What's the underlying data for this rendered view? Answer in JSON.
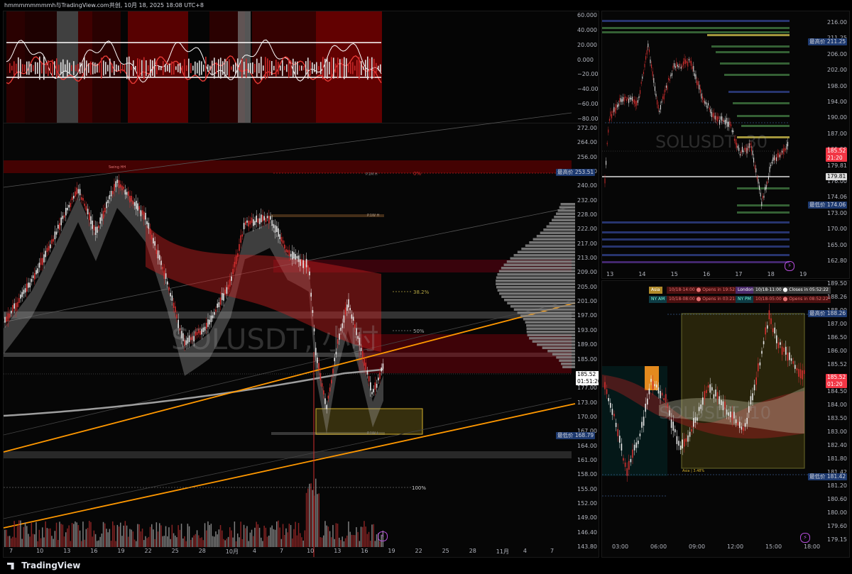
{
  "header": {
    "text": "hmmmmmmmmh与TradingView.com共创, 10月 18, 2025 18:08 UTC+8"
  },
  "footer": {
    "brand": "TradingView"
  },
  "icons": {
    "logo": "tradingview-logo-icon",
    "lightning": "lightning-icon"
  },
  "colors": {
    "bull": "#e8e8e8",
    "bear": "#d32f2f",
    "orange": "#ff9800",
    "red_tag": "#f23645",
    "blue_tag": "#1e3a70",
    "olive": "#b5a642"
  },
  "main_chart": {
    "symbol_watermark": "SOLUSDT, 小时",
    "price_axis": [
      "272.00",
      "264.00",
      "256.00",
      "248.00",
      "240.00",
      "232.00",
      "228.00",
      "222.00",
      "217.00",
      "213.00",
      "209.00",
      "205.00",
      "201.00",
      "197.00",
      "193.00",
      "189.00",
      "185.00",
      "181.00",
      "177.00",
      "173.00",
      "170.00",
      "167.00",
      "164.00",
      "161.00",
      "158.00",
      "155.00",
      "152.00",
      "149.00",
      "146.40",
      "143.80"
    ],
    "time_axis": [
      "7",
      "10",
      "13",
      "16",
      "19",
      "22",
      "25",
      "28",
      "10月",
      "4",
      "7",
      "10",
      "13",
      "16",
      "19",
      "22",
      "25",
      "28",
      "11月",
      "4",
      "7"
    ],
    "high_label": "最高价",
    "high_value": "253.51",
    "low_label": "最低价",
    "low_value": "168.79",
    "current_price": "185.52",
    "current_timer": "01:51:20",
    "fib": {
      "zero": "0%",
      "f382": "38.2%",
      "f50": "50%",
      "f100": "100%"
    },
    "labels": {
      "swing_hh": "Swing HH",
      "p1m_h": "P.1M H",
      "p1w_h": "P.1W H",
      "p1w_l": "P.1W L"
    }
  },
  "oscillator": {
    "axis": [
      "60.000",
      "40.000",
      "20.000",
      "0.000",
      "−20.000",
      "−40.000",
      "−60.000",
      "−80.000"
    ]
  },
  "right_top": {
    "watermark": "SOLUSDT, 30",
    "price_axis": [
      "216.00",
      "211.25",
      "206.00",
      "202.00",
      "198.00",
      "194.00",
      "190.00",
      "187.00",
      "185.52",
      "179.81",
      "176.00",
      "174.06",
      "173.00",
      "170.00",
      "165.00",
      "162.80"
    ],
    "time_axis": [
      "13",
      "14",
      "15",
      "16",
      "17",
      "18",
      "19"
    ],
    "high_label": "最高价",
    "high_value": "211.25",
    "low_label": "最低价",
    "low_value": "174.06",
    "current_price": "185.52",
    "current_timer": "21:20",
    "level_value": "179.81"
  },
  "right_bottom": {
    "watermark": "SOLUSDT, 10",
    "price_axis": [
      "189.50",
      "188.26",
      "188.00",
      "187.00",
      "186.50",
      "186.00",
      "185.52",
      "185.00",
      "184.50",
      "184.00",
      "183.50",
      "183.00",
      "182.40",
      "181.80",
      "181.42",
      "181.20",
      "180.60",
      "180.00",
      "179.60",
      "179.15"
    ],
    "time_axis": [
      "03:00",
      "06:00",
      "09:00",
      "12:00",
      "15:00",
      "18:00"
    ],
    "high_label": "最高价",
    "high_value": "188.26",
    "low_label": "最低价",
    "low_value": "181.42",
    "current_price": "185.52",
    "current_timer": "01:20",
    "asia_range": "Asia | 3.48%",
    "sessions": [
      {
        "name": "Asia",
        "info": "10/18-14:00 ⬤ Opens in 19:52:22"
      },
      {
        "name": "London",
        "info": "10/18-11:00 ⬤ Closes in 05:52:22"
      },
      {
        "name": "NY AM",
        "info": "10/18-08:00 ⬤ Opens in 03:21:22"
      },
      {
        "name": "NY PM",
        "info": "10/18-05:00 ⬤ Opens in 08:52:22"
      }
    ]
  }
}
